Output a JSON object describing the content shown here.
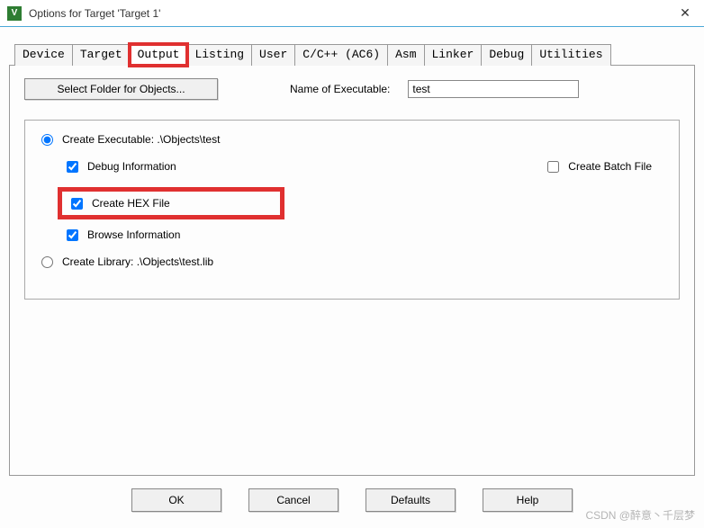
{
  "window": {
    "title": "Options for Target 'Target 1'",
    "icon_letter": "V"
  },
  "tabs": {
    "items": [
      {
        "label": "Device"
      },
      {
        "label": "Target"
      },
      {
        "label": "Output",
        "active": true,
        "highlight": true
      },
      {
        "label": "Listing"
      },
      {
        "label": "User"
      },
      {
        "label": "C/C++ (AC6)"
      },
      {
        "label": "Asm"
      },
      {
        "label": "Linker"
      },
      {
        "label": "Debug"
      },
      {
        "label": "Utilities"
      }
    ]
  },
  "output": {
    "select_folder_label": "Select Folder for Objects...",
    "name_label": "Name of Executable:",
    "name_value": "test",
    "create_exec_label": "Create Executable:  .\\Objects\\test",
    "debug_info_label": "Debug Information",
    "create_hex_label": "Create HEX File",
    "browse_info_label": "Browse Information",
    "create_batch_label": "Create Batch File",
    "create_lib_label": "Create Library:  .\\Objects\\test.lib",
    "debug_info_checked": true,
    "create_hex_checked": true,
    "browse_info_checked": true,
    "create_batch_checked": false,
    "radio_selected": "exec"
  },
  "buttons": {
    "ok": "OK",
    "cancel": "Cancel",
    "defaults": "Defaults",
    "help": "Help"
  },
  "watermark": "CSDN @醉意丶千层梦"
}
